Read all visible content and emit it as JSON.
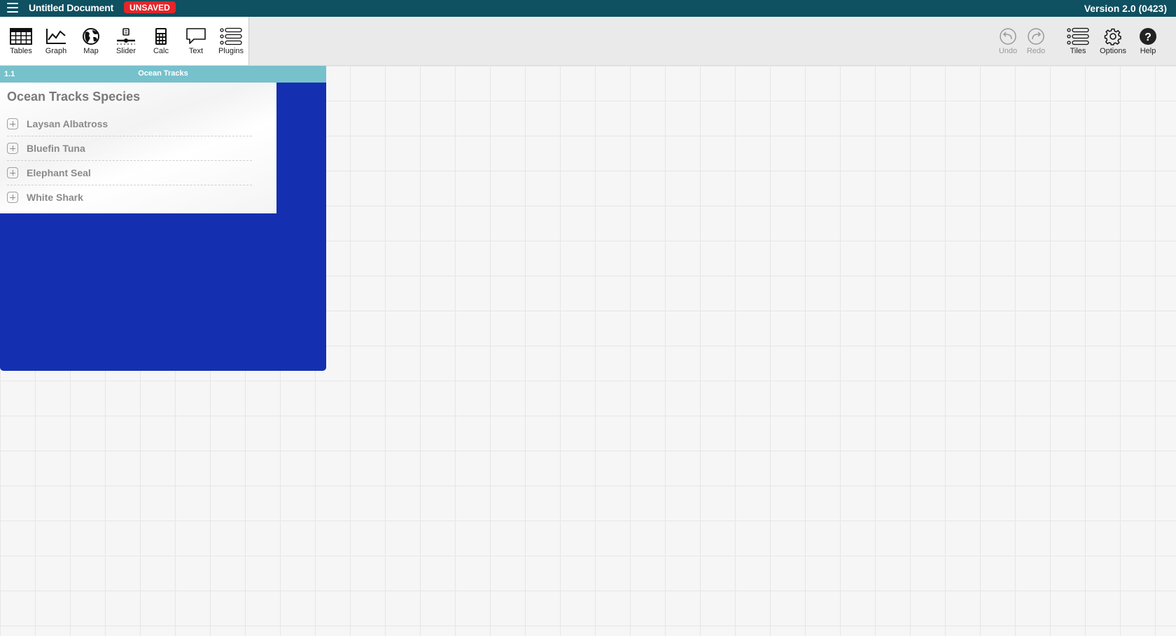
{
  "titlebar": {
    "title": "Untitled Document",
    "status_badge": "UNSAVED",
    "version": "Version 2.0 (0423)"
  },
  "toolbar": {
    "left_tools": [
      {
        "label": "Tables",
        "icon": "table-icon"
      },
      {
        "label": "Graph",
        "icon": "graph-icon"
      },
      {
        "label": "Map",
        "icon": "globe-icon"
      },
      {
        "label": "Slider",
        "icon": "slider-icon"
      },
      {
        "label": "Calc",
        "icon": "calculator-icon"
      },
      {
        "label": "Text",
        "icon": "speech-bubble-icon"
      },
      {
        "label": "Plugins",
        "icon": "plugins-list-icon"
      }
    ],
    "right_tools": [
      {
        "label": "Undo",
        "icon": "undo-icon",
        "disabled": true
      },
      {
        "label": "Redo",
        "icon": "redo-icon",
        "disabled": true
      },
      {
        "label": "Tiles",
        "icon": "tiles-list-icon"
      },
      {
        "label": "Options",
        "icon": "gear-icon"
      },
      {
        "label": "Help",
        "icon": "help-icon"
      }
    ]
  },
  "tile": {
    "index": "1.1",
    "title": "Ocean Tracks",
    "heading": "Ocean Tracks Species",
    "species": [
      {
        "name": "Laysan Albatross"
      },
      {
        "name": "Bluefin Tuna"
      },
      {
        "name": "Elephant Seal"
      },
      {
        "name": "White Shark"
      }
    ]
  },
  "colors": {
    "titlebar": "#0f5061",
    "unsaved": "#e3262a",
    "tile_header": "#77c1cc",
    "tile_body": "#1430b0"
  }
}
